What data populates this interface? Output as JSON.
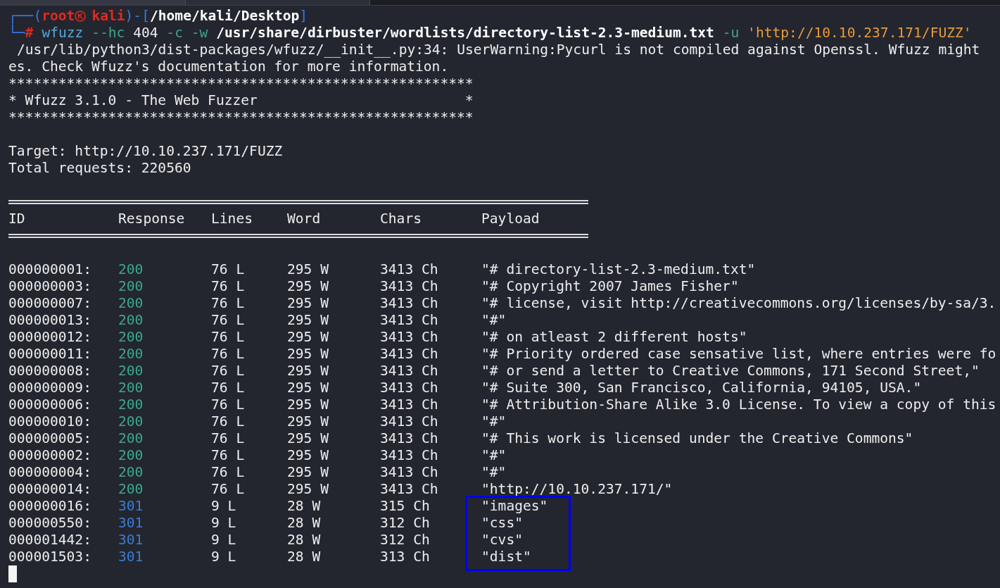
{
  "prompt": {
    "frame_open": "┌──(",
    "user": "root",
    "host": "kali",
    "frame_middle": ")-[",
    "directory": "/home/kali/Desktop",
    "frame_close": "]",
    "frame_lower": "└─",
    "symbol": "#"
  },
  "command": [
    {
      "kind": "command",
      "text": "wfuzz"
    },
    {
      "kind": "option",
      "text": "--hc"
    },
    {
      "kind": "argument",
      "text": "404"
    },
    {
      "kind": "option",
      "text": "-c"
    },
    {
      "kind": "option",
      "text": "-w"
    },
    {
      "kind": "path",
      "text": "/usr/share/dirbuster/wordlists/directory-list-2.3-medium.txt"
    },
    {
      "kind": "option",
      "text": "-u"
    },
    {
      "kind": "string",
      "text": "'http://10.10.237.171/FUZZ'"
    }
  ],
  "warning_lines": [
    "/usr/lib/python3/dist-packages/wfuzz/__init__.py:34: UserWarning:Pycurl is not compiled against Openssl. Wfuzz might",
    "es. Check Wfuzz's documentation for more information."
  ],
  "banner": [
    "********************************************************",
    "* Wfuzz 3.1.0 - The Web Fuzzer                         *",
    "********************************************************"
  ],
  "target": "Target: http://10.10.237.171/FUZZ",
  "total_requests": "Total requests: 220560",
  "table": {
    "columns": [
      "ID",
      "Response",
      "Lines",
      "Word",
      "Chars",
      "Payload"
    ],
    "rows": [
      {
        "id": "000000001:",
        "response": "200",
        "color": "#3ca88c",
        "lines": "76 L",
        "word": "295 W",
        "chars": "3413 Ch",
        "payload": "\"# directory-list-2.3-medium.txt\""
      },
      {
        "id": "000000003:",
        "response": "200",
        "color": "#3ca88c",
        "lines": "76 L",
        "word": "295 W",
        "chars": "3413 Ch",
        "payload": "\"# Copyright 2007 James Fisher\""
      },
      {
        "id": "000000007:",
        "response": "200",
        "color": "#3ca88c",
        "lines": "76 L",
        "word": "295 W",
        "chars": "3413 Ch",
        "payload": "\"# license, visit http://creativecommons.org/licenses/by-sa/3."
      },
      {
        "id": "000000013:",
        "response": "200",
        "color": "#3ca88c",
        "lines": "76 L",
        "word": "295 W",
        "chars": "3413 Ch",
        "payload": "\"#\""
      },
      {
        "id": "000000012:",
        "response": "200",
        "color": "#3ca88c",
        "lines": "76 L",
        "word": "295 W",
        "chars": "3413 Ch",
        "payload": "\"# on atleast 2 different hosts\""
      },
      {
        "id": "000000011:",
        "response": "200",
        "color": "#3ca88c",
        "lines": "76 L",
        "word": "295 W",
        "chars": "3413 Ch",
        "payload": "\"# Priority ordered case sensative list, where entries were fo"
      },
      {
        "id": "000000008:",
        "response": "200",
        "color": "#3ca88c",
        "lines": "76 L",
        "word": "295 W",
        "chars": "3413 Ch",
        "payload": "\"# or send a letter to Creative Commons, 171 Second Street,\""
      },
      {
        "id": "000000009:",
        "response": "200",
        "color": "#3ca88c",
        "lines": "76 L",
        "word": "295 W",
        "chars": "3413 Ch",
        "payload": "\"# Suite 300, San Francisco, California, 94105, USA.\""
      },
      {
        "id": "000000006:",
        "response": "200",
        "color": "#3ca88c",
        "lines": "76 L",
        "word": "295 W",
        "chars": "3413 Ch",
        "payload": "\"# Attribution-Share Alike 3.0 License. To view a copy of this"
      },
      {
        "id": "000000010:",
        "response": "200",
        "color": "#3ca88c",
        "lines": "76 L",
        "word": "295 W",
        "chars": "3413 Ch",
        "payload": "\"#\""
      },
      {
        "id": "000000005:",
        "response": "200",
        "color": "#3ca88c",
        "lines": "76 L",
        "word": "295 W",
        "chars": "3413 Ch",
        "payload": "\"# This work is licensed under the Creative Commons\""
      },
      {
        "id": "000000002:",
        "response": "200",
        "color": "#3ca88c",
        "lines": "76 L",
        "word": "295 W",
        "chars": "3413 Ch",
        "payload": "\"#\""
      },
      {
        "id": "000000004:",
        "response": "200",
        "color": "#3ca88c",
        "lines": "76 L",
        "word": "295 W",
        "chars": "3413 Ch",
        "payload": "\"#\""
      },
      {
        "id": "000000014:",
        "response": "200",
        "color": "#3ca88c",
        "lines": "76 L",
        "word": "295 W",
        "chars": "3413 Ch",
        "payload": "\"http://10.10.237.171/\""
      },
      {
        "id": "000000016:",
        "response": "301",
        "color": "#3a7bd5",
        "lines": "9 L",
        "word": "28 W",
        "chars": "315 Ch",
        "payload": "\"images\""
      },
      {
        "id": "000000550:",
        "response": "301",
        "color": "#3a7bd5",
        "lines": "9 L",
        "word": "28 W",
        "chars": "312 Ch",
        "payload": "\"css\""
      },
      {
        "id": "000001442:",
        "response": "301",
        "color": "#3a7bd5",
        "lines": "9 L",
        "word": "28 W",
        "chars": "312 Ch",
        "payload": "\"cvs\""
      },
      {
        "id": "000001503:",
        "response": "301",
        "color": "#3a7bd5",
        "lines": "9 L",
        "word": "28 W",
        "chars": "313 Ch",
        "payload": "\"dist\""
      }
    ]
  }
}
